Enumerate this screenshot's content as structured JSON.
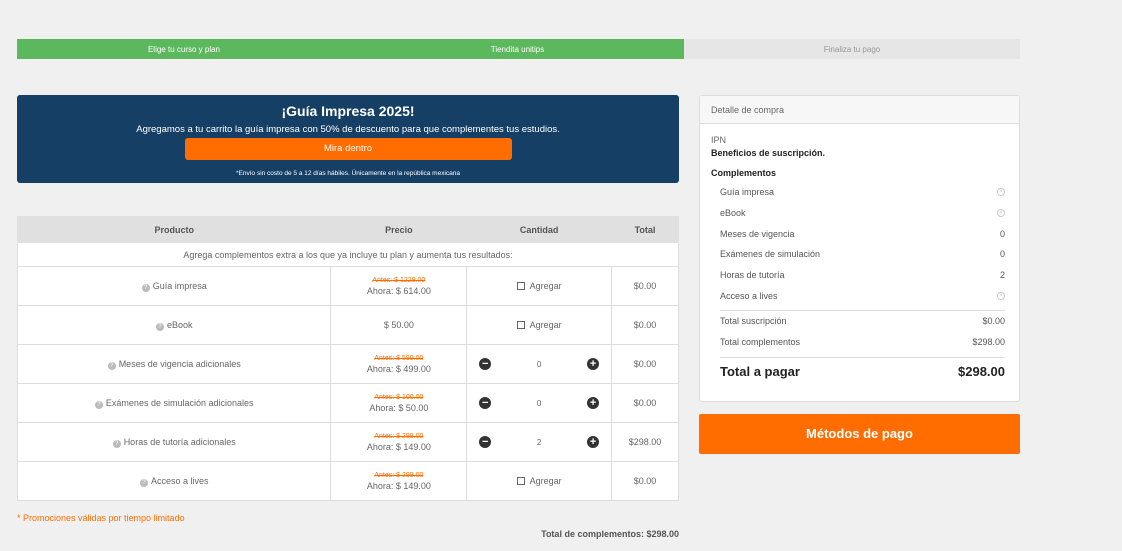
{
  "steps": [
    "Elige tu curso y plan",
    "Tiendita unitips",
    "Finaliza tu pago"
  ],
  "promo": {
    "title": "¡Guía Impresa 2025!",
    "text": "Agregamos a tu carrito la guía impresa con 50% de descuento para que complementes tus estudios.",
    "button": "Mira dentro",
    "note": "*Envío sin costo de 5 a 12 días hábiles. Únicamente en la república mexicana"
  },
  "table": {
    "headers": [
      "Producto",
      "Precio",
      "Cantidad",
      "Total"
    ],
    "note": "Agrega complementos extra a los que ya incluye tu plan y aumenta tus resultados:",
    "rows": [
      {
        "name": "Guía impresa",
        "old": "Antes: $ 1229.00",
        "price": "Ahora: $ 614.00",
        "qty_label": "Agregar",
        "total": "$0.00"
      },
      {
        "name": "eBook",
        "price": "$ 50.00",
        "qty_label": "Agregar",
        "total": "$0.00"
      },
      {
        "name": "Meses de vigencia adicionales",
        "old": "Antes: $ 599.00",
        "price": "Ahora: $ 499.00",
        "qty": "0",
        "total": "$0.00"
      },
      {
        "name": "Exámenes de simulación adicionales",
        "old": "Antes: $ 100.00",
        "price": "Ahora: $ 50.00",
        "qty": "0",
        "total": "$0.00"
      },
      {
        "name": "Horas de tutoría adicionales",
        "old": "Antes: $ 298.00",
        "price": "Ahora: $ 149.00",
        "qty": "2",
        "total": "$298.00"
      },
      {
        "name": "Acceso a lives",
        "old": "Antes: $ 299.00",
        "price": "Ahora: $ 149.00",
        "qty_label": "Agregar",
        "total": "$0.00"
      }
    ]
  },
  "footer": {
    "promo_note": "* Promociones válidas por tiempo limitado",
    "total_complementos": "Total de complementos: $298.00"
  },
  "summary": {
    "header": "Detalle de compra",
    "plan": "IPN",
    "benefits": "Beneficios de suscripción.",
    "comp_title": "Complementos",
    "lines": [
      {
        "label": "Guía impresa",
        "value": "⊗"
      },
      {
        "label": "eBook",
        "value": "⊗"
      },
      {
        "label": "Meses de vigencia",
        "value": "0"
      },
      {
        "label": "Exámenes de simulación",
        "value": "0"
      },
      {
        "label": "Horas de tutoría",
        "value": "2"
      },
      {
        "label": "Acceso a lives",
        "value": "⊗"
      }
    ],
    "total_suscripcion_label": "Total suscripción",
    "total_suscripcion": "$0.00",
    "total_complementos_label": "Total complementos",
    "total_complementos": "$298.00",
    "total_label": "Total a pagar",
    "total": "$298.00"
  },
  "pay_button": "Métodos de pago",
  "colors": {
    "accent": "#ff6d00",
    "progress": "#5cb85c",
    "banner": "#163f66"
  }
}
